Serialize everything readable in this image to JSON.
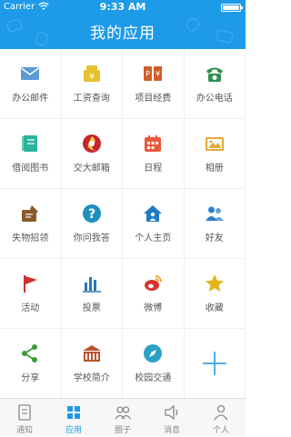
{
  "status_bar": {
    "carrier": "Carrier",
    "time": "9:33 AM"
  },
  "header": {
    "title": "我的应用"
  },
  "apps": [
    {
      "label": "办公邮件",
      "icon": "envelope-icon",
      "color": "#5a9bd5"
    },
    {
      "label": "工资查询",
      "icon": "money-bag-icon",
      "color": "#e8c12e"
    },
    {
      "label": "项目经费",
      "icon": "project-funding-icon",
      "color": "#d35c2b"
    },
    {
      "label": "办公电话",
      "icon": "telephone-icon",
      "color": "#2f8f4e"
    },
    {
      "label": "借阅图书",
      "icon": "book-icon",
      "color": "#2bb39b"
    },
    {
      "label": "交大邮箱",
      "icon": "university-mail-logo-icon",
      "color": "#c4262e"
    },
    {
      "label": "日程",
      "icon": "calendar-icon",
      "color": "#e85a3a"
    },
    {
      "label": "相册",
      "icon": "photo-album-icon",
      "color": "#e1a93a"
    },
    {
      "label": "失物招领",
      "icon": "lost-found-icon",
      "color": "#8a5a2b"
    },
    {
      "label": "你问我答",
      "icon": "question-icon",
      "color": "#1f8fc0"
    },
    {
      "label": "个人主页",
      "icon": "home-icon",
      "color": "#1e7bc6"
    },
    {
      "label": "好友",
      "icon": "friends-icon",
      "color": "#2d7fc9"
    },
    {
      "label": "活动",
      "icon": "flag-icon",
      "color": "#d0302f"
    },
    {
      "label": "投票",
      "icon": "bar-chart-icon",
      "color": "#2878b8"
    },
    {
      "label": "微博",
      "icon": "weibo-icon",
      "color": "#d6342e"
    },
    {
      "label": "收藏",
      "icon": "star-icon",
      "color": "#e2b41c"
    },
    {
      "label": "分享",
      "icon": "share-icon",
      "color": "#3a9d3a"
    },
    {
      "label": "学校简介",
      "icon": "school-building-icon",
      "color": "#b9532f"
    },
    {
      "label": "校园交通",
      "icon": "compass-icon",
      "color": "#2aa1c7"
    },
    {
      "label": "",
      "icon": "add-icon",
      "color": "#3aa3e6"
    }
  ],
  "tabbar": [
    {
      "label": "通知",
      "icon": "notice-icon",
      "active": false
    },
    {
      "label": "应用",
      "icon": "apps-icon",
      "active": true
    },
    {
      "label": "圈子",
      "icon": "circle-icon",
      "active": false
    },
    {
      "label": "消息",
      "icon": "message-icon",
      "active": false
    },
    {
      "label": "个人",
      "icon": "person-icon",
      "active": false
    }
  ],
  "colors": {
    "primary": "#1e9be8",
    "divider": "#eceff1",
    "tab_inactive": "#888888"
  }
}
